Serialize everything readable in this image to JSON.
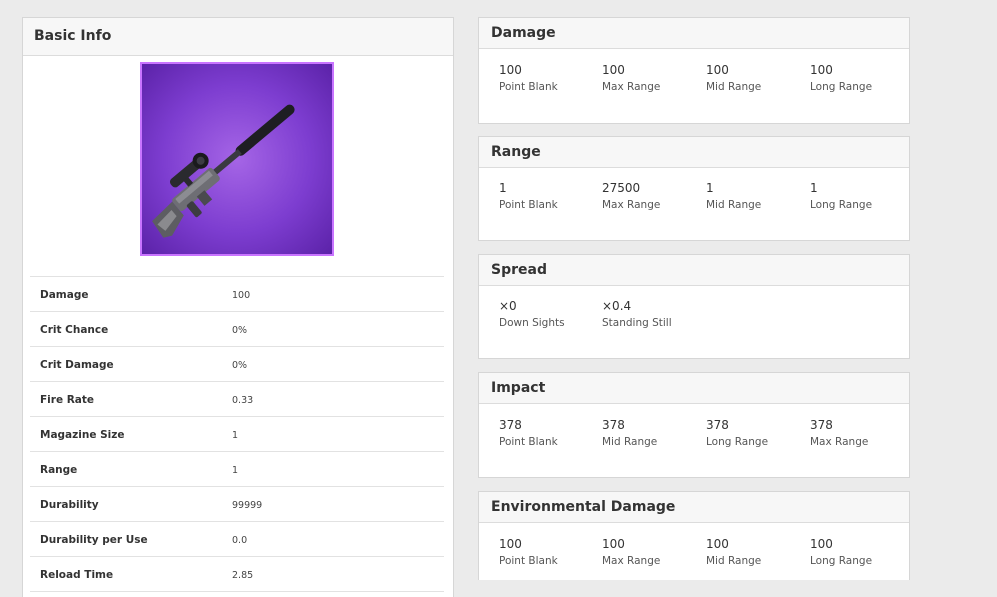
{
  "basic_info": {
    "title": "Basic Info",
    "stats": [
      {
        "label": "Damage",
        "value": "100"
      },
      {
        "label": "Crit Chance",
        "value": "0%"
      },
      {
        "label": "Crit Damage",
        "value": "0%"
      },
      {
        "label": "Fire Rate",
        "value": "0.33"
      },
      {
        "label": "Magazine Size",
        "value": "1"
      },
      {
        "label": "Range",
        "value": "1"
      },
      {
        "label": "Durability",
        "value": "99999"
      },
      {
        "label": "Durability per Use",
        "value": "0.0"
      },
      {
        "label": "Reload Time",
        "value": "2.85"
      }
    ]
  },
  "panels": {
    "damage": {
      "title": "Damage",
      "cells": [
        {
          "value": "100",
          "label": "Point Blank"
        },
        {
          "value": "100",
          "label": "Max Range"
        },
        {
          "value": "100",
          "label": "Mid Range"
        },
        {
          "value": "100",
          "label": "Long Range"
        }
      ]
    },
    "range": {
      "title": "Range",
      "cells": [
        {
          "value": "1",
          "label": "Point Blank"
        },
        {
          "value": "27500",
          "label": "Max Range"
        },
        {
          "value": "1",
          "label": "Mid Range"
        },
        {
          "value": "1",
          "label": "Long Range"
        }
      ]
    },
    "spread": {
      "title": "Spread",
      "cells": [
        {
          "value": "×0",
          "label": "Down Sights"
        },
        {
          "value": "×0.4",
          "label": "Standing Still"
        }
      ]
    },
    "impact": {
      "title": "Impact",
      "cells": [
        {
          "value": "378",
          "label": "Point Blank"
        },
        {
          "value": "378",
          "label": "Mid Range"
        },
        {
          "value": "378",
          "label": "Long Range"
        },
        {
          "value": "378",
          "label": "Max Range"
        }
      ]
    },
    "environmental_damage": {
      "title": "Environmental Damage",
      "cells": [
        {
          "value": "100",
          "label": "Point Blank"
        },
        {
          "value": "100",
          "label": "Max Range"
        },
        {
          "value": "100",
          "label": "Mid Range"
        },
        {
          "value": "100",
          "label": "Long Range"
        }
      ]
    }
  },
  "colors": {
    "page_background": "#ebebeb",
    "image_border": "#c974ff",
    "image_background": "#7d3dd0"
  },
  "icons": {
    "weapon_image": "suppressed-sniper-rifle"
  }
}
